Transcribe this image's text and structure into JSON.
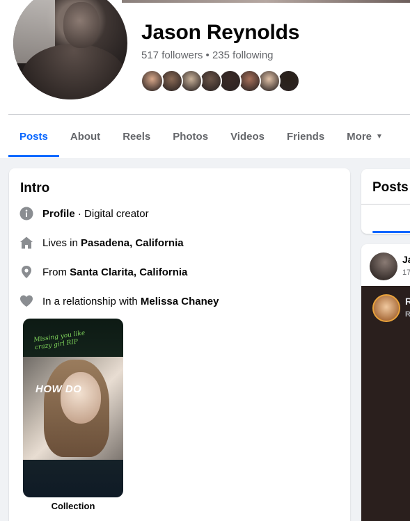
{
  "profile": {
    "name": "Jason Reynolds",
    "followers_line": "517 followers • 235 following"
  },
  "friend_faces": [
    "#d9a88a",
    "#8a6a55",
    "#c9b29a",
    "#6b5548",
    "#3a2a26",
    "#a7705a",
    "#e1c2a8",
    "#2a2019"
  ],
  "tabs": [
    {
      "label": "Posts",
      "active": true
    },
    {
      "label": "About"
    },
    {
      "label": "Reels"
    },
    {
      "label": "Photos"
    },
    {
      "label": "Videos"
    },
    {
      "label": "Friends"
    },
    {
      "label": "More"
    }
  ],
  "intro": {
    "title": "Intro",
    "profile_label": "Profile",
    "profile_sep": " · ",
    "profile_type": "Digital creator",
    "lives_prefix": "Lives in ",
    "lives_place": "Pasadena, California",
    "from_prefix": "From ",
    "from_place": "Santa Clarita, California",
    "rel_prefix": "In a relationship with ",
    "rel_name": "Melissa Chaney",
    "collection": {
      "script_text": "Missing you like crazy girl RIP",
      "overlay_text": "HOW DO",
      "label": "Collection"
    }
  },
  "posts_panel": {
    "title": "Posts"
  },
  "feed": {
    "post1_name": "Ja",
    "post1_time": "17",
    "post2_name": "R",
    "post2_sub": "R"
  },
  "colors": {
    "accent": "#0866ff",
    "muted_text": "#65676b",
    "background": "#f0f2f5"
  }
}
